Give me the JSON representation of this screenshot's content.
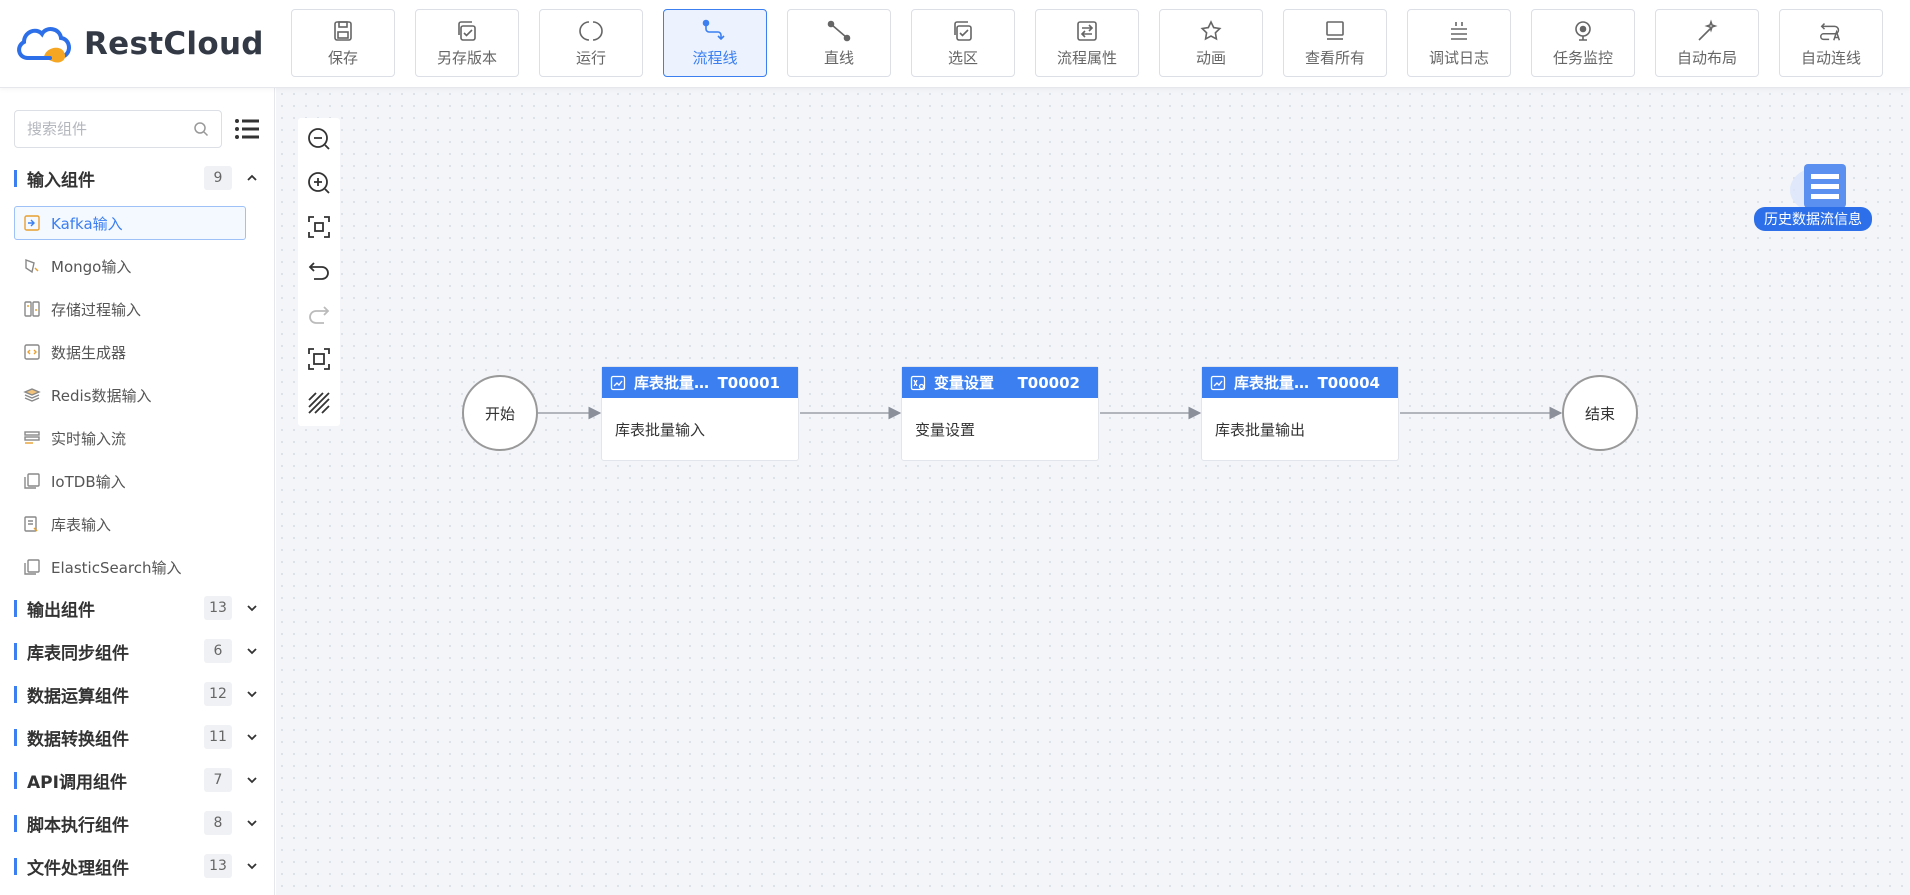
{
  "app": {
    "logo_text": "RestCloud"
  },
  "toolbar": [
    {
      "id": "save",
      "label": "保存",
      "icon": "save-icon"
    },
    {
      "id": "save-version",
      "label": "另存版本",
      "icon": "copy-icon"
    },
    {
      "id": "run",
      "label": "运行",
      "icon": "run-icon"
    },
    {
      "id": "flowline",
      "label": "流程线",
      "icon": "flowline-icon",
      "active": true
    },
    {
      "id": "straight",
      "label": "直线",
      "icon": "line-icon"
    },
    {
      "id": "select",
      "label": "选区",
      "icon": "select-icon"
    },
    {
      "id": "props",
      "label": "流程属性",
      "icon": "properties-icon"
    },
    {
      "id": "animation",
      "label": "动画",
      "icon": "star-icon"
    },
    {
      "id": "view-all",
      "label": "查看所有",
      "icon": "view-all-icon"
    },
    {
      "id": "debug-log",
      "label": "调试日志",
      "icon": "log-icon"
    },
    {
      "id": "monitor",
      "label": "任务监控",
      "icon": "monitor-icon"
    },
    {
      "id": "auto-layout",
      "label": "自动布局",
      "icon": "magic-wand-icon"
    },
    {
      "id": "auto-connect",
      "label": "自动连线",
      "icon": "auto-connect-icon"
    }
  ],
  "sidebar": {
    "search_placeholder": "搜索组件",
    "groups": [
      {
        "title": "输入组件",
        "count": "9",
        "expanded": true,
        "items": [
          {
            "label": "Kafka输入",
            "selected": true
          },
          {
            "label": "Mongo输入"
          },
          {
            "label": "存储过程输入"
          },
          {
            "label": "数据生成器"
          },
          {
            "label": "Redis数据输入"
          },
          {
            "label": "实时输入流"
          },
          {
            "label": "IoTDB输入"
          },
          {
            "label": "库表输入"
          },
          {
            "label": "ElasticSearch输入"
          }
        ]
      },
      {
        "title": "输出组件",
        "count": "13"
      },
      {
        "title": "库表同步组件",
        "count": "6"
      },
      {
        "title": "数据运算组件",
        "count": "12"
      },
      {
        "title": "数据转换组件",
        "count": "11"
      },
      {
        "title": "API调用组件",
        "count": "7"
      },
      {
        "title": "脚本执行组件",
        "count": "8"
      },
      {
        "title": "文件处理组件",
        "count": "13"
      }
    ]
  },
  "canvas": {
    "history_badge": "历史数据流信息",
    "start_label": "开始",
    "end_label": "结束",
    "tasks": [
      {
        "title": "库表批量…",
        "id": "T00001",
        "body": "库表批量输入"
      },
      {
        "title": "变量设置",
        "id": "T00002",
        "body": "变量设置"
      },
      {
        "title": "库表批量…",
        "id": "T00004",
        "body": "库表批量输出"
      }
    ]
  },
  "colors": {
    "accent": "#3b7ff1",
    "canvas_bg": "#f3f5f9"
  }
}
